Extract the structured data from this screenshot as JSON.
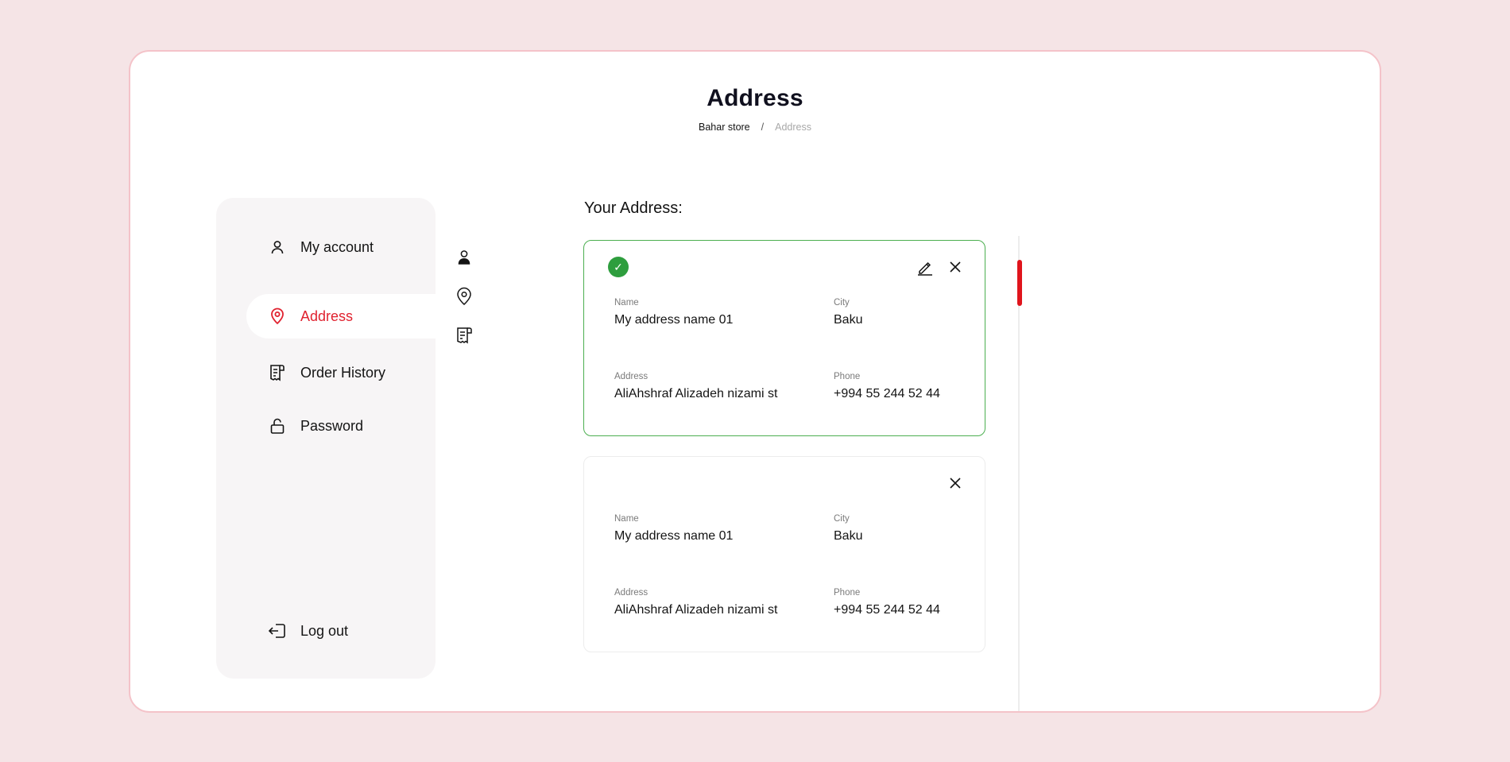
{
  "page": {
    "title": "Address",
    "breadcrumb": {
      "home": "Bahar store",
      "separator": "/",
      "current": "Address"
    }
  },
  "sidebar": {
    "items": [
      {
        "label": "My account",
        "icon": "user-icon"
      },
      {
        "label": "Address",
        "icon": "location-pin-icon",
        "active": true
      },
      {
        "label": "Order History",
        "icon": "receipt-icon"
      },
      {
        "label": "Password",
        "icon": "unlock-icon"
      }
    ],
    "logout": {
      "label": "Log out",
      "icon": "logout-icon"
    }
  },
  "main": {
    "section_label": "Your Address:",
    "addresses": [
      {
        "selected": true,
        "name_label": "Name",
        "name": "My address name 01",
        "city_label": "City",
        "city": "Baku",
        "address_label": "Address",
        "address": "AliAhshraf Alizadeh nizami st",
        "phone_label": "Phone",
        "phone": "+994 55 244 52 44"
      },
      {
        "selected": false,
        "name_label": "Name",
        "name": "My address name 01",
        "city_label": "City",
        "city": "Baku",
        "address_label": "Address",
        "address": "AliAhshraf Alizadeh nizami st",
        "phone_label": "Phone",
        "phone": "+994 55 244 52 44"
      }
    ]
  },
  "colors": {
    "accent": "#e0222f",
    "selected_border": "#4caf50",
    "check": "#2e9e3e",
    "background": "#f5e4e6",
    "frame_border": "#f4c3c9"
  }
}
